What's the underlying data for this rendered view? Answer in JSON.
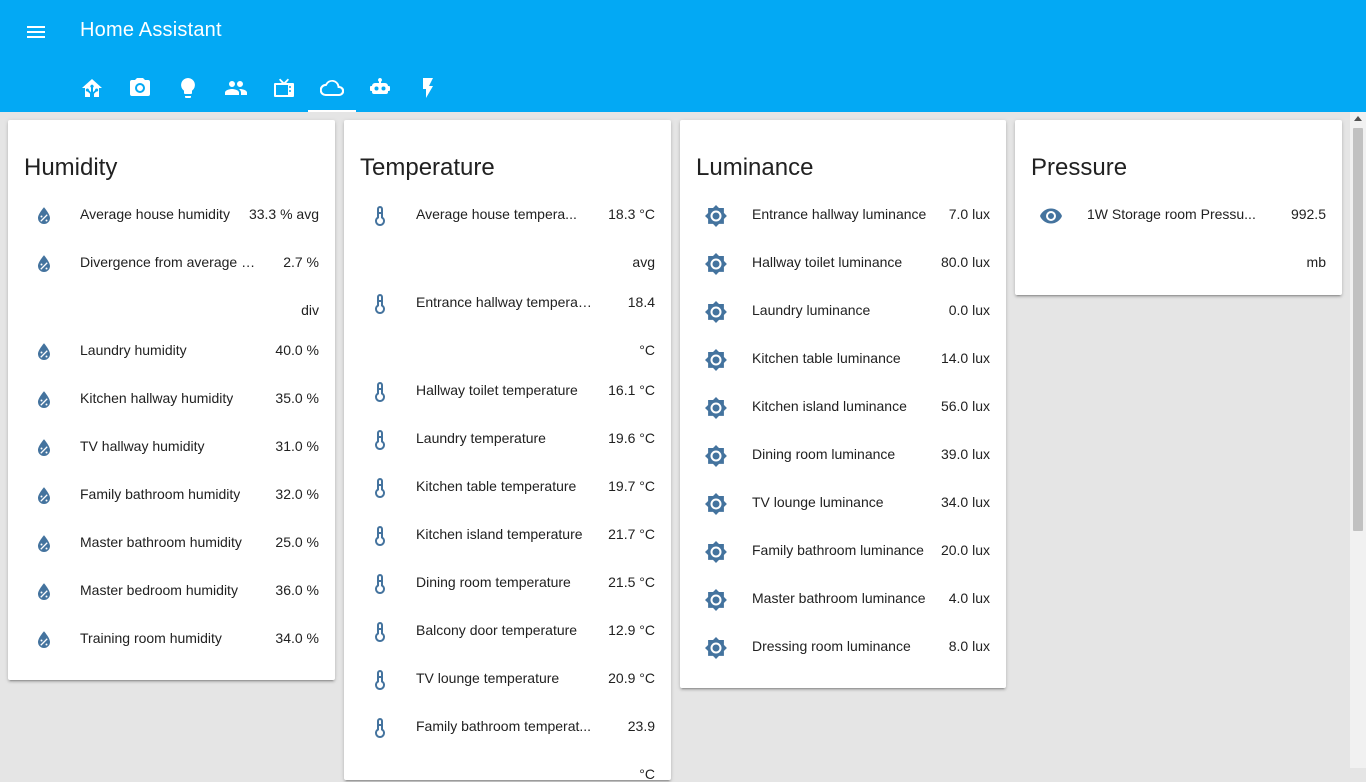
{
  "app": {
    "title": "Home Assistant"
  },
  "tabs": [
    {
      "icon": "home-assistant-icon"
    },
    {
      "icon": "camera-icon"
    },
    {
      "icon": "lightbulb-icon"
    },
    {
      "icon": "people-icon"
    },
    {
      "icon": "television-icon"
    },
    {
      "icon": "cloud-icon",
      "active": true
    },
    {
      "icon": "robot-icon"
    },
    {
      "icon": "flash-icon"
    }
  ],
  "cards": {
    "humidity": {
      "title": "Humidity",
      "items": [
        {
          "name": "Average house humidity",
          "value": "33.3 % avg"
        },
        {
          "name": "Divergence from average h...",
          "value": "2.7 %",
          "value2": "div"
        },
        {
          "name": "Laundry humidity",
          "value": "40.0 %"
        },
        {
          "name": "Kitchen hallway humidity",
          "value": "35.0 %"
        },
        {
          "name": "TV hallway humidity",
          "value": "31.0 %"
        },
        {
          "name": "Family bathroom humidity",
          "value": "32.0 %"
        },
        {
          "name": "Master bathroom humidity",
          "value": "25.0 %"
        },
        {
          "name": "Master bedroom humidity",
          "value": "36.0 %"
        },
        {
          "name": "Training room humidity",
          "value": "34.0 %"
        }
      ]
    },
    "temperature": {
      "title": "Temperature",
      "items": [
        {
          "name": "Average house tempera...",
          "value": "18.3 °C",
          "value2": "avg"
        },
        {
          "name": "Entrance hallway temperat...",
          "value": "18.4",
          "value2": "°C"
        },
        {
          "name": "Hallway toilet temperature",
          "value": "16.1 °C"
        },
        {
          "name": "Laundry temperature",
          "value": "19.6 °C"
        },
        {
          "name": "Kitchen table temperature",
          "value": "19.7 °C"
        },
        {
          "name": "Kitchen island temperature",
          "value": "21.7 °C"
        },
        {
          "name": "Dining room temperature",
          "value": "21.5 °C"
        },
        {
          "name": "Balcony door temperature",
          "value": "12.9 °C"
        },
        {
          "name": "TV lounge temperature",
          "value": "20.9 °C"
        },
        {
          "name": "Family bathroom temperat...",
          "value": "23.9",
          "value2": "°C"
        }
      ]
    },
    "luminance": {
      "title": "Luminance",
      "items": [
        {
          "name": "Entrance hallway luminance",
          "value": "7.0 lux"
        },
        {
          "name": "Hallway toilet luminance",
          "value": "80.0 lux"
        },
        {
          "name": "Laundry luminance",
          "value": "0.0 lux"
        },
        {
          "name": "Kitchen table luminance",
          "value": "14.0 lux"
        },
        {
          "name": "Kitchen island luminance",
          "value": "56.0 lux"
        },
        {
          "name": "Dining room luminance",
          "value": "39.0 lux"
        },
        {
          "name": "TV lounge luminance",
          "value": "34.0 lux"
        },
        {
          "name": "Family bathroom luminance",
          "value": "20.0 lux"
        },
        {
          "name": "Master bathroom luminance",
          "value": "4.0 lux"
        },
        {
          "name": "Dressing room luminance",
          "value": "8.0 lux"
        }
      ]
    },
    "pressure": {
      "title": "Pressure",
      "items": [
        {
          "name": "1W Storage room Pressu...",
          "value": "992.5",
          "value2": "mb"
        }
      ]
    }
  },
  "colors": {
    "header": "#03a9f4",
    "icon": "#44739e",
    "background": "#e5e5e5"
  }
}
